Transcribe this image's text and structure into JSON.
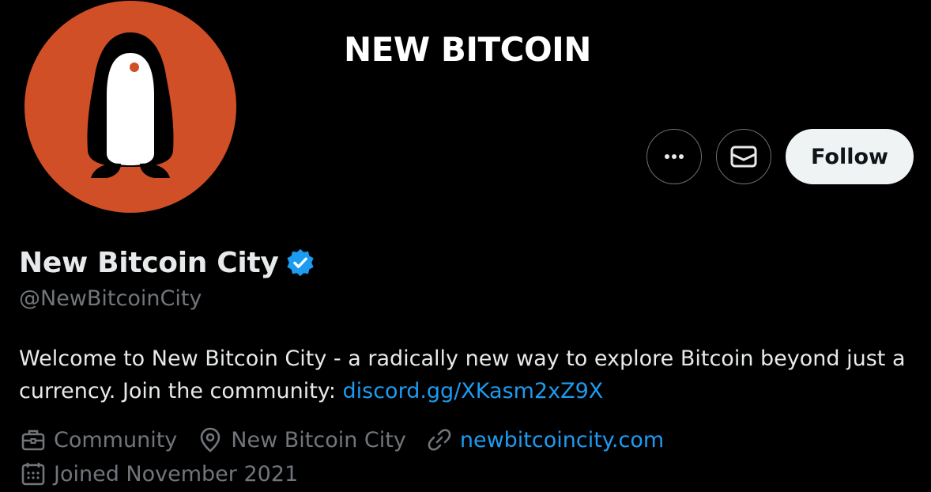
{
  "banner": {
    "title": "NEW BITCOIN"
  },
  "profile": {
    "display_name": "New Bitcoin City",
    "verified": true,
    "handle": "@NewBitcoinCity",
    "bio_text": "Welcome to New Bitcoin City - a radically new way to explore Bitcoin beyond just a currency. Join the community: ",
    "bio_link": "discord.gg/XKasm2xZ9X",
    "category": "Community",
    "location": "New Bitcoin City",
    "website": "newbitcoincity.com",
    "joined": "Joined November 2021"
  },
  "actions": {
    "more_icon": "more-horizontal-icon",
    "message_icon": "envelope-icon",
    "follow_label": "Follow"
  },
  "colors": {
    "background": "#000000",
    "avatar_bg": "#d14f26",
    "link": "#1d9bf0",
    "secondary_text": "#71767b",
    "verified_badge": "#1d9bf0"
  }
}
